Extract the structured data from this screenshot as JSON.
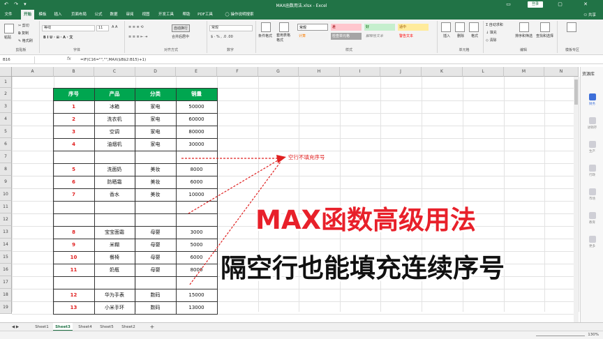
{
  "titlebar": {
    "quick_access": "↶ ↷ ▾",
    "title": "MAX函数用法.xlsx  -  Excel",
    "login": "登录",
    "window_buttons": "▭ — ▢ ✕"
  },
  "menu": {
    "tabs": [
      "文件",
      "开始",
      "模板",
      "插入",
      "页面布局",
      "公式",
      "数据",
      "审阅",
      "视图",
      "开发工具",
      "帮助",
      "PDF工具",
      "操作说明搜索"
    ],
    "active": "开始",
    "share": "共享"
  },
  "ribbon": {
    "clipboard": {
      "paste": "粘贴",
      "cut": "剪切",
      "copy": "复制",
      "format_painter": "格式刷",
      "group": "剪贴板"
    },
    "font": {
      "name": "等线",
      "size": "11",
      "grow": "A A",
      "style": "B  I  U  ·  ⊞  ·  A  ·  文",
      "group": "字体"
    },
    "alignment": {
      "wrap": "自动换行",
      "merge": "合并后居中",
      "group": "对齐方式"
    },
    "number": {
      "format": "常规",
      "symbols": "$ · % ,  .0  .00",
      "group": "数字"
    },
    "styles": {
      "cond_format": "条件格式",
      "table_format": "套用表格格式",
      "cells": [
        {
          "label": "常规",
          "bg": "#ffffff",
          "color": "#000000"
        },
        {
          "label": "差",
          "bg": "#ffc7ce",
          "color": "#9c0006"
        },
        {
          "label": "好",
          "bg": "#c6efce",
          "color": "#006100"
        },
        {
          "label": "适中",
          "bg": "#ffeb9c",
          "color": "#9c5700"
        },
        {
          "label": "计算",
          "bg": "#f2f2f2",
          "color": "#fa7d00"
        },
        {
          "label": "检查单元格",
          "bg": "#a5a5a5",
          "color": "#ffffff"
        },
        {
          "label": "解释性文本",
          "bg": "#f3f3f3",
          "color": "#7f7f7f"
        },
        {
          "label": "警告文本",
          "bg": "#f3f3f3",
          "color": "#ff0000"
        }
      ],
      "group": "样式"
    },
    "cells_group": {
      "insert": "插入",
      "delete": "删除",
      "format": "格式",
      "group": "单元格"
    },
    "editing": {
      "autosum": "自动求和",
      "fill": "填充",
      "clear": "清除",
      "sort_filter": "排序和筛选",
      "find_select": "查找和选择",
      "group": "编辑"
    },
    "template": {
      "group": "模板专区"
    }
  },
  "formula_bar": {
    "name_box": "B16",
    "fx": "fx",
    "formula": "=IF(C16=\"\",\"\",MAX($B$2:B15)+1)"
  },
  "columns": [
    "A",
    "B",
    "C",
    "D",
    "E",
    "F",
    "G",
    "H",
    "I",
    "J",
    "K",
    "L",
    "M",
    "N"
  ],
  "rows": [
    "1",
    "2",
    "3",
    "4",
    "5",
    "6",
    "7",
    "8",
    "9",
    "10",
    "11",
    "12",
    "13",
    "14",
    "15",
    "16",
    "17",
    "18",
    "19"
  ],
  "table": {
    "headers": [
      "序号",
      "产品",
      "分类",
      "销量"
    ],
    "rows": [
      [
        "1",
        "冰箱",
        "家电",
        "50000"
      ],
      [
        "2",
        "洗衣机",
        "家电",
        "60000"
      ],
      [
        "3",
        "空调",
        "家电",
        "80000"
      ],
      [
        "4",
        "油烟机",
        "家电",
        "30000"
      ],
      [
        "",
        "",
        "",
        ""
      ],
      [
        "5",
        "洗面奶",
        "美妆",
        "8000"
      ],
      [
        "6",
        "防晒霜",
        "美妆",
        "6000"
      ],
      [
        "7",
        "香水",
        "美妆",
        "10000"
      ],
      [
        "",
        "",
        "",
        ""
      ],
      [
        "",
        "",
        "",
        ""
      ],
      [
        "8",
        "宝宝面霜",
        "母婴",
        "3000"
      ],
      [
        "9",
        "米糊",
        "母婴",
        "5000"
      ],
      [
        "10",
        "餐椅",
        "母婴",
        "6000"
      ],
      [
        "11",
        "奶瓶",
        "母婴",
        "8000"
      ],
      [
        "",
        "",
        "",
        ""
      ],
      [
        "12",
        "华为手表",
        "数码",
        "15000"
      ],
      [
        "13",
        "小米手环",
        "数码",
        "13000"
      ]
    ]
  },
  "annotation": "空行不填充序号",
  "overlay": {
    "line1": "MAX函数高级用法",
    "line2": "隔空行也能填充连续序号"
  },
  "side_pane": {
    "title": "资源库",
    "items": [
      "财务",
      "进销存",
      "生产",
      "行政",
      "市场",
      "教育",
      "更多"
    ]
  },
  "sheets": {
    "tabs": [
      "Sheet1",
      "Sheet3",
      "Sheet4",
      "Sheet5",
      "Sheet2"
    ],
    "active": "Sheet3",
    "add": "+"
  },
  "status": {
    "zoom": "130%"
  }
}
